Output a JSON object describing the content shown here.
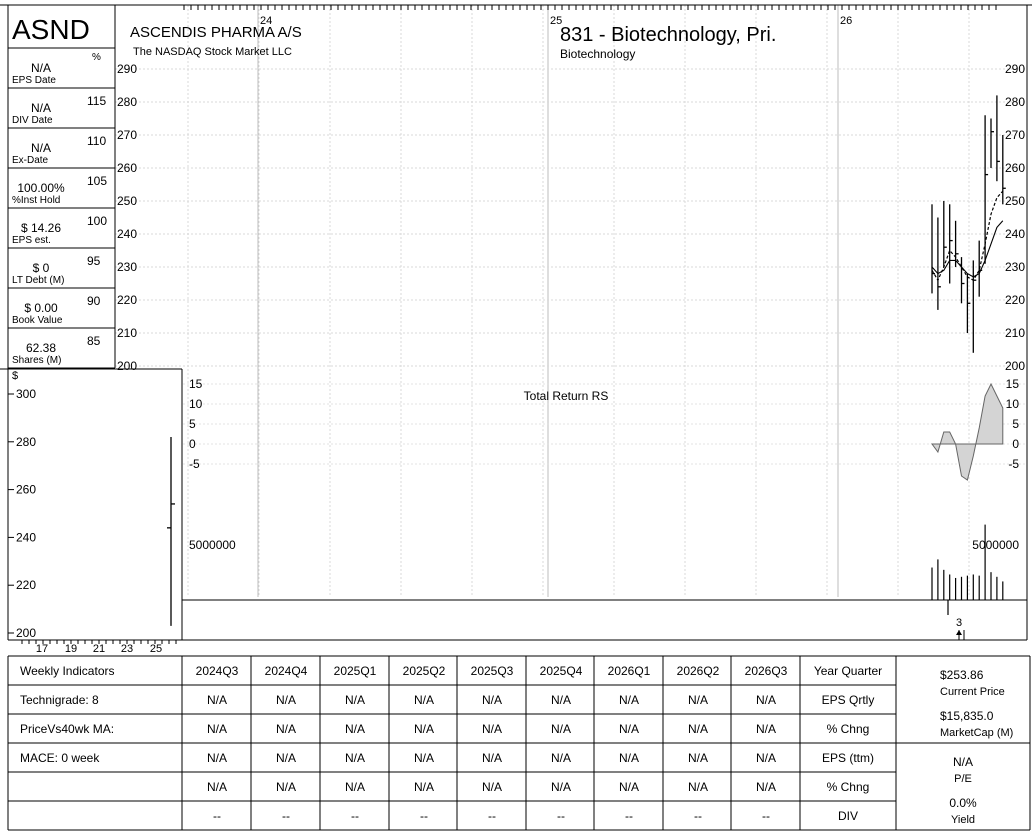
{
  "header": {
    "ticker": "ASND",
    "company": "ASCENDIS PHARMA A/S",
    "exchange": "The NASDAQ Stock Market LLC",
    "industry": "831 - Biotechnology, Pri.",
    "sector": "Biotechnology"
  },
  "left_panel": [
    {
      "value": "N/A",
      "label": "EPS Date"
    },
    {
      "value": "N/A",
      "label": "DIV Date"
    },
    {
      "value": "N/A",
      "label": "Ex-Date"
    },
    {
      "value": "100.00%",
      "label": "%Inst Hold"
    },
    {
      "value": "$ 14.26",
      "label": "EPS est."
    },
    {
      "value": "$ 0",
      "label": "LT Debt (M)"
    },
    {
      "value": "$ 0.00",
      "label": "Book Value"
    },
    {
      "value": "62.38",
      "label": "Shares (M)"
    }
  ],
  "pct_axis": {
    "symbol": "%",
    "ticks": [
      "115",
      "110",
      "105",
      "100",
      "95",
      "90",
      "85"
    ]
  },
  "chart_data": [
    {
      "type": "candlestick",
      "title": "Price",
      "x_labels": [
        "24",
        "25",
        "26"
      ],
      "y_ticks": [
        200,
        210,
        220,
        230,
        240,
        250,
        260,
        270,
        280,
        290
      ],
      "ylim": [
        200,
        290
      ],
      "bars": [
        {
          "high": 249,
          "low": 222,
          "close": 228
        },
        {
          "high": 245,
          "low": 217,
          "close": 224
        },
        {
          "high": 250,
          "low": 230,
          "close": 236
        },
        {
          "high": 249,
          "low": 225,
          "close": 238
        },
        {
          "high": 244,
          "low": 230,
          "close": 234
        },
        {
          "high": 233,
          "low": 219,
          "close": 225
        },
        {
          "high": 228,
          "low": 210,
          "close": 219
        },
        {
          "high": 232,
          "low": 204,
          "close": 226
        },
        {
          "high": 238,
          "low": 221,
          "close": 229
        },
        {
          "high": 276,
          "low": 231,
          "close": 258
        },
        {
          "high": 275,
          "low": 260,
          "close": 271
        },
        {
          "high": 282,
          "low": 256,
          "close": 262
        },
        {
          "high": 270,
          "low": 249,
          "close": 253.86
        }
      ],
      "ma_short": [
        229,
        226,
        230,
        235,
        233,
        230,
        227,
        226,
        229,
        237,
        246,
        251,
        253
      ],
      "ma_long": [
        230,
        228,
        229,
        232,
        232,
        230,
        228,
        227,
        228,
        232,
        237,
        242,
        244
      ]
    },
    {
      "type": "area",
      "title": "Total Return RS",
      "y_ticks": [
        15,
        10,
        5,
        0,
        -5
      ],
      "ylim": [
        -10,
        15
      ],
      "values": [
        0,
        -2,
        3,
        3,
        0,
        -8,
        -9,
        -3,
        4,
        12,
        15,
        12,
        9
      ]
    },
    {
      "type": "bar",
      "title": "Volume",
      "label": "5000000",
      "values": [
        2800000,
        3500000,
        2600000,
        2200000,
        1900000,
        2000000,
        2100000,
        2200000,
        2100000,
        6500000,
        2400000,
        2000000,
        1600000
      ]
    },
    {
      "type": "line",
      "title": "Inset",
      "currency": "$",
      "x_labels": [
        "17",
        "19",
        "21",
        "23",
        "25"
      ],
      "y_ticks": [
        200,
        220,
        240,
        260,
        280,
        300
      ],
      "ylim": [
        200,
        300
      ],
      "bar": {
        "high": 282,
        "low": 203,
        "open": 244,
        "close": 254
      }
    }
  ],
  "marker": {
    "text": "3"
  },
  "table": {
    "row_labels": [
      "Weekly Indicators",
      "Technigrade: 8",
      "PriceVs40wk MA:",
      "MACE:   0 week",
      "",
      ""
    ],
    "quarters": [
      "2024Q3",
      "2024Q4",
      "2025Q1",
      "2025Q2",
      "2025Q3",
      "2025Q4",
      "2026Q1",
      "2026Q2",
      "2026Q3"
    ],
    "rows": [
      [
        "N/A",
        "N/A",
        "N/A",
        "N/A",
        "N/A",
        "N/A",
        "N/A",
        "N/A",
        "N/A"
      ],
      [
        "N/A",
        "N/A",
        "N/A",
        "N/A",
        "N/A",
        "N/A",
        "N/A",
        "N/A",
        "N/A"
      ],
      [
        "N/A",
        "N/A",
        "N/A",
        "N/A",
        "N/A",
        "N/A",
        "N/A",
        "N/A",
        "N/A"
      ],
      [
        "N/A",
        "N/A",
        "N/A",
        "N/A",
        "N/A",
        "N/A",
        "N/A",
        "N/A",
        "N/A"
      ],
      [
        "--",
        "--",
        "--",
        "--",
        "--",
        "--",
        "--",
        "--",
        "--"
      ]
    ],
    "metric_labels": [
      "Year Quarter",
      "EPS Qrtly",
      "% Chng",
      "EPS (ttm)",
      "% Chng",
      "DIV"
    ]
  },
  "summary": {
    "current_price": "$253.86",
    "current_price_label": "Current Price",
    "market_cap": "$15,835.0",
    "market_cap_label": "MarketCap (M)",
    "pe": "N/A",
    "pe_label": "P/E",
    "yield": "0.0%",
    "yield_label": "Yield"
  }
}
